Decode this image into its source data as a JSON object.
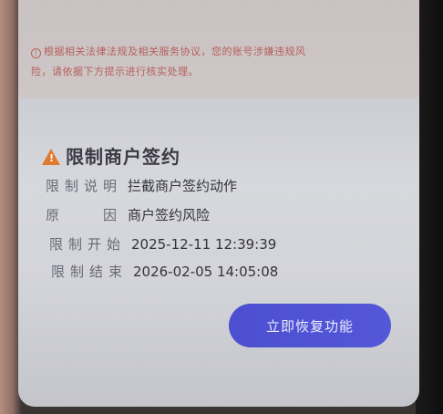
{
  "notice": {
    "line1": "根据相关法律法规及相关服务协议，您的账号涉嫌违规风",
    "line2": "险，请依据下方提示进行核实处理。",
    "icon": "info-circle-icon"
  },
  "restriction": {
    "title": "限制商户签约",
    "title_icon": "warning-icon",
    "rows": [
      {
        "label": "限制说明",
        "value": "拦截商户签约动作"
      },
      {
        "label": "原　　因",
        "value": "商户签约风险"
      },
      {
        "label": "限制开始",
        "value": "2025-12-11 12:39:39"
      },
      {
        "label": "限制结束",
        "value": "2026-02-05 14:05:08"
      }
    ]
  },
  "actions": {
    "restore_label": "立即恢复功能"
  },
  "colors": {
    "accent": "#5054d4",
    "warning": "#e07a2e",
    "notice_text": "#b5605c"
  }
}
